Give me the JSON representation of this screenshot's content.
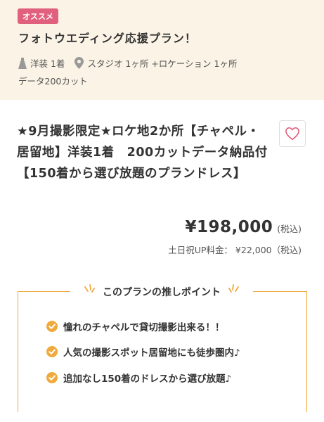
{
  "plan": {
    "badge": "オススメ",
    "type_title": "フォトウエディング応援プラン！",
    "costume": "洋装 1着",
    "location": "スタジオ 1ヶ所 +ロケーション 1ヶ所",
    "data": "データ200カット"
  },
  "detail": {
    "title": "★9月撮影限定★ロケ地2か所【チャペル・居留地】洋装1着　200カットデータ納品付　【150着から選び放題のプランドレス】",
    "price": "¥198,000",
    "tax_note": "(税込)",
    "weekend_fee": "土日祝UP料金：  ¥22,000（税込)"
  },
  "points": {
    "heading": "このプランの推しポイント",
    "items": [
      "憧れのチャペルで貸切撮影出来る！！",
      "人気の撮影スポット居留地にも徒歩圏内♪",
      "追加なし150着のドレスから選び放題♪"
    ]
  },
  "colors": {
    "badge_bg": "#e0607e",
    "top_bg": "#faf3e6",
    "accent_orange": "#f0a93c",
    "heart": "#e0607e"
  },
  "icons": [
    "dress-icon",
    "location-pin-icon",
    "heart-icon",
    "check-circle-icon",
    "sparkle-icon"
  ]
}
